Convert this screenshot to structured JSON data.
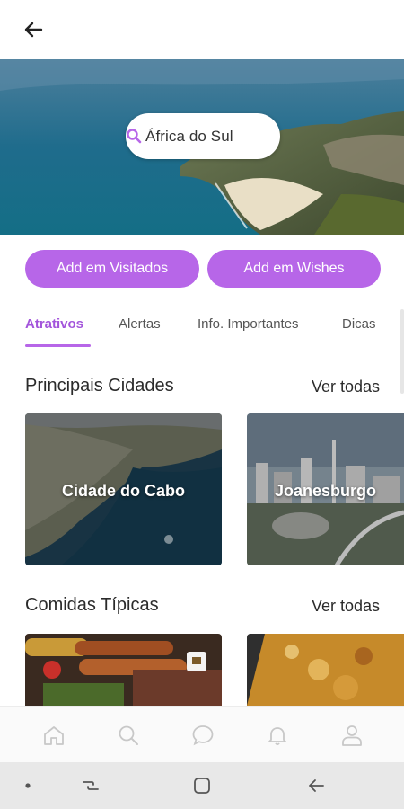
{
  "header": {
    "back_icon": "arrow-left-icon"
  },
  "search": {
    "value": "África do Sul",
    "icon": "search-icon"
  },
  "actions": {
    "visited_label": "Add em Visitados",
    "wishes_label": "Add em Wishes"
  },
  "tabs": [
    {
      "label": "Atrativos",
      "active": true
    },
    {
      "label": "Alertas",
      "active": false
    },
    {
      "label": "Info. Importantes",
      "active": false
    },
    {
      "label": "Dicas",
      "active": false
    }
  ],
  "cities": {
    "title": "Principais Cidades",
    "see_all": "Ver todas",
    "items": [
      {
        "name": "Cidade do Cabo"
      },
      {
        "name": "Joanesburgo"
      }
    ]
  },
  "foods": {
    "title": "Comidas Típicas",
    "see_all": "Ver todas"
  },
  "bottom_nav": [
    "home-icon",
    "search-icon",
    "chat-icon",
    "bell-icon",
    "user-icon"
  ],
  "system_nav": [
    "dot-icon",
    "recent-apps-icon",
    "home-square-icon",
    "back-arrow-icon"
  ],
  "colors": {
    "accent": "#b766e8",
    "accent_text": "#a355db"
  }
}
